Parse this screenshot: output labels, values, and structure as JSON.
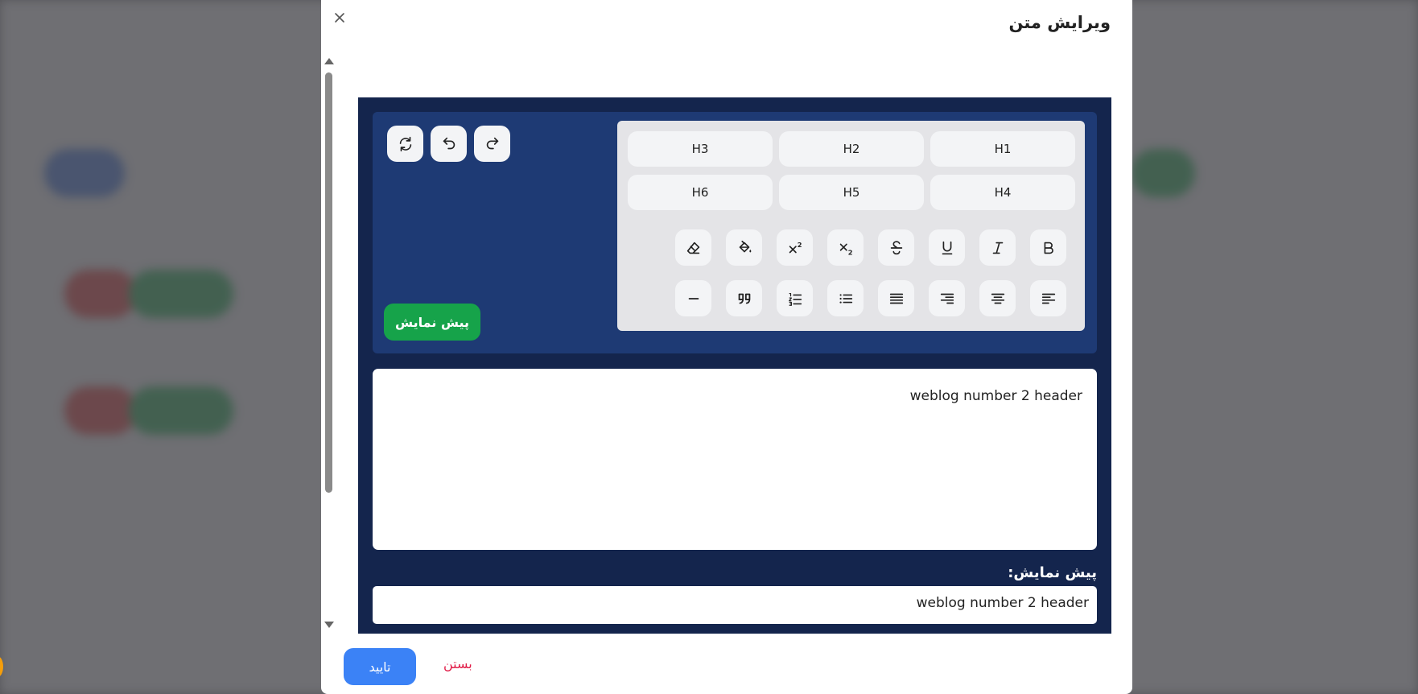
{
  "modal": {
    "title": "ویرایش متن",
    "close_icon": "close-icon"
  },
  "toolbar": {
    "headings": [
      "H1",
      "H2",
      "H3",
      "H4",
      "H5",
      "H6"
    ],
    "format_icons": [
      "bold-icon",
      "italic-icon",
      "underline-icon",
      "strikethrough-icon",
      "subscript-icon",
      "superscript-icon",
      "fill-color-icon",
      "eraser-icon"
    ],
    "align_icons": [
      "align-left-icon",
      "align-center-icon",
      "align-right-icon",
      "align-justify-icon",
      "bullet-list-icon",
      "numbered-list-icon",
      "quote-icon",
      "horizontal-rule-icon"
    ],
    "history_icons": [
      "redo-icon",
      "undo-icon",
      "refresh-icon"
    ],
    "preview_button": "پیش نمایش"
  },
  "editor": {
    "content": "weblog number 2 header"
  },
  "preview": {
    "label": "پیش نمایش:",
    "content": "weblog number 2 header"
  },
  "footer": {
    "confirm": "تایید",
    "close": "بستن"
  },
  "colors": {
    "editor_bg": "#14254d",
    "toolbar_bg": "#1e3a74",
    "preview_button": "#16a34a",
    "confirm_button": "#3b82f6",
    "close_link": "#e11d48"
  }
}
